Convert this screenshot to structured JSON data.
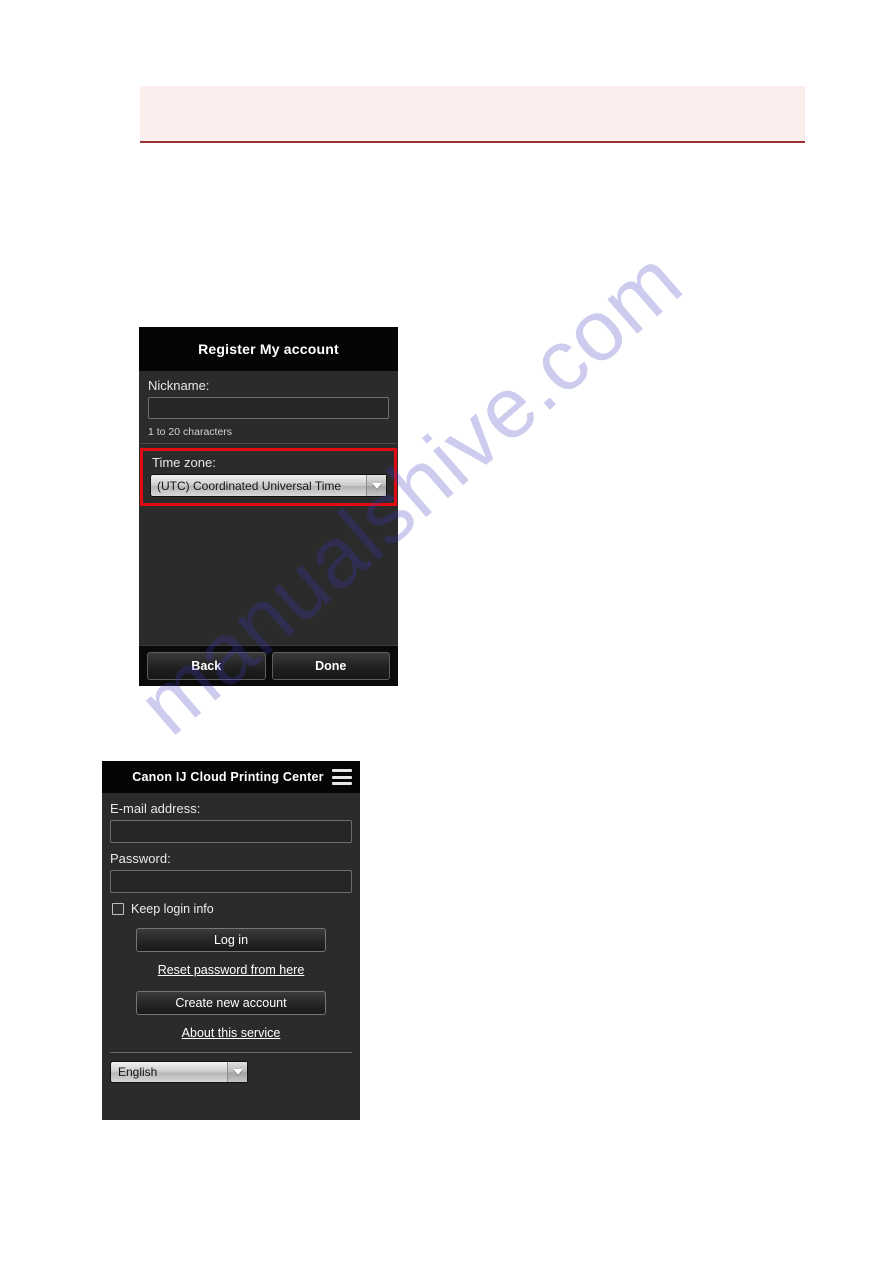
{
  "notice": {
    "text": ""
  },
  "watermark": {
    "text": "manualshive.com"
  },
  "register_panel": {
    "title": "Register My account",
    "nickname": {
      "label": "Nickname:",
      "value": "",
      "placeholder": "",
      "hint": "1 to 20 characters"
    },
    "timezone": {
      "label": "Time zone:",
      "selected": "(UTC) Coordinated Universal Time",
      "arrow_icon": "chevron-down-icon"
    },
    "highlight_color": "#e30b13",
    "buttons": {
      "back": "Back",
      "done": "Done"
    }
  },
  "login_panel": {
    "title": "Canon IJ Cloud Printing Center",
    "menu_icon": "hamburger-menu-icon",
    "email": {
      "label": "E-mail address:",
      "value": "",
      "placeholder": ""
    },
    "password": {
      "label": "Password:",
      "value": "",
      "placeholder": ""
    },
    "keep_login": {
      "label": "Keep login info",
      "checked": false
    },
    "login_button": "Log in",
    "reset_link": "Reset password from here",
    "create_account_button": "Create new account",
    "about_link": "About this service",
    "language": {
      "selected": "English",
      "arrow_icon": "chevron-down-icon"
    }
  },
  "colors": {
    "panel_background": "#2b2b2b",
    "titlebar_background": "#050505",
    "notice_background": "#fdeeee",
    "notice_border": "#993333",
    "highlight_red": "#e30b13"
  }
}
